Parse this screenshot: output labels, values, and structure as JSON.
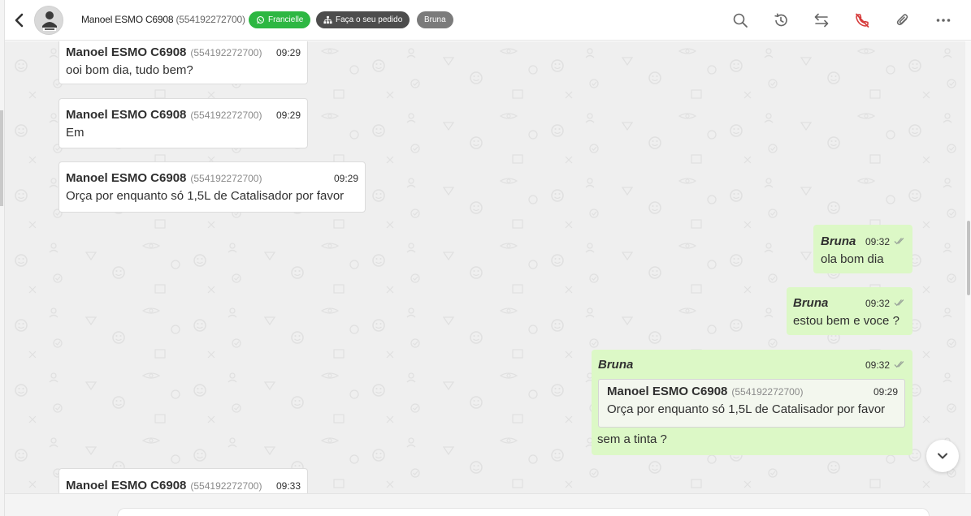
{
  "header": {
    "contact_name": "Manoel ESMO C6908",
    "contact_phone": "(554192272700)",
    "tags": [
      "Francielle",
      "Faça o seu pedido",
      "Bruna"
    ],
    "colors": {
      "whatsapp_green": "#2db742",
      "tag_dark": "#4d4d4d",
      "tag_gray": "#7b7b7b"
    },
    "icons": [
      "back-icon",
      "search-icon",
      "history-icon",
      "transfer-icon",
      "end-call-icon",
      "attachment-icon",
      "more-icon"
    ]
  },
  "messages": [
    {
      "direction": "in",
      "sender": "Manoel ESMO C6908",
      "phone": "(554192272700)",
      "time": "09:29",
      "text": "ooi bom dia, tudo bem?"
    },
    {
      "direction": "in",
      "sender": "Manoel ESMO C6908",
      "phone": "(554192272700)",
      "time": "09:29",
      "text": "Em"
    },
    {
      "direction": "in",
      "sender": "Manoel ESMO C6908",
      "phone": "(554192272700)",
      "time": "09:29",
      "text": "Orça por enquanto só 1,5L de Catalisador por favor"
    },
    {
      "direction": "out",
      "sender": "Bruna",
      "time": "09:32",
      "text": "ola bom dia"
    },
    {
      "direction": "out",
      "sender": "Bruna",
      "time": "09:32",
      "text": "estou bem e voce ?"
    },
    {
      "direction": "out",
      "sender": "Bruna",
      "time": "09:32",
      "text": "sem a tinta ?",
      "quoted": {
        "sender": "Manoel ESMO C6908",
        "phone": "(554192272700)",
        "time": "09:29",
        "text": "Orça por enquanto só 1,5L de Catalisador por favor"
      }
    },
    {
      "direction": "in",
      "sender": "Manoel ESMO C6908",
      "phone": "(554192272700)",
      "time": "09:33",
      "text": ""
    }
  ],
  "colors": {
    "incoming_bubble": "#ffffff",
    "outgoing_bubble": "#dcf8c6",
    "chat_background": "#efefef"
  }
}
